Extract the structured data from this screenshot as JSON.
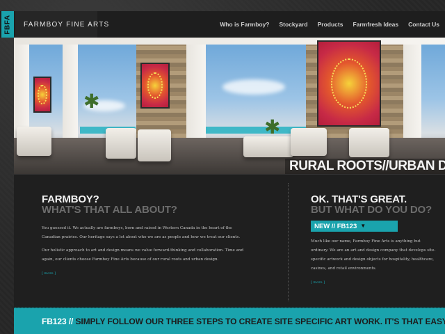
{
  "header": {
    "logo_text": "FBFA",
    "brand": "FARMBOY FINE ARTS",
    "nav": [
      {
        "label": "Who is Farmboy?"
      },
      {
        "label": "Stockyard"
      },
      {
        "label": "Products"
      },
      {
        "label": "Farmfresh Ideas"
      },
      {
        "label": "Contact Us"
      }
    ]
  },
  "hero": {
    "tagline": "RURAL ROOTS//URBAN DESIG"
  },
  "left": {
    "heading": "FARMBOY?",
    "subheading": "WHAT'S THAT ALL ABOUT?",
    "para1": "You guessed it. We actually are farmboys, born and raised in Western Canada in the heart of the Canadian prairies. Our heritage says a lot about who we are as people and how we treat our clients.",
    "para2": "Our holistic approach to art and design means we value forward-thinking and collaboration. Time and again, our clients choose Farmboy Fine Arts because of our rural roots and urban design.",
    "more": "[ more ]"
  },
  "right": {
    "heading": "OK. THAT'S GREAT.",
    "subheading": "BUT WHAT DO YOU DO?",
    "new_label": "NEW // FB123",
    "para": "Much like our name, Farmboy Fine Arts is anything but ordinary. We are an art and design company that develops site-specific artwork and design objects for hospitality, healthcare, casinos, and retail environments.",
    "more": "[ more ]"
  },
  "banner": {
    "highlight": "FB123 //",
    "text": " SIMPLY FOLLOW OUR THREE STEPS TO CREATE SITE SPECIFIC ART WORK. IT'S THAT EASY!"
  },
  "colors": {
    "accent": "#1aa3ad",
    "header_bg": "#1e1e1e",
    "content_bg": "#1f1f1f"
  },
  "icons": {
    "new_bar_arrow": "arrow-down-icon"
  }
}
